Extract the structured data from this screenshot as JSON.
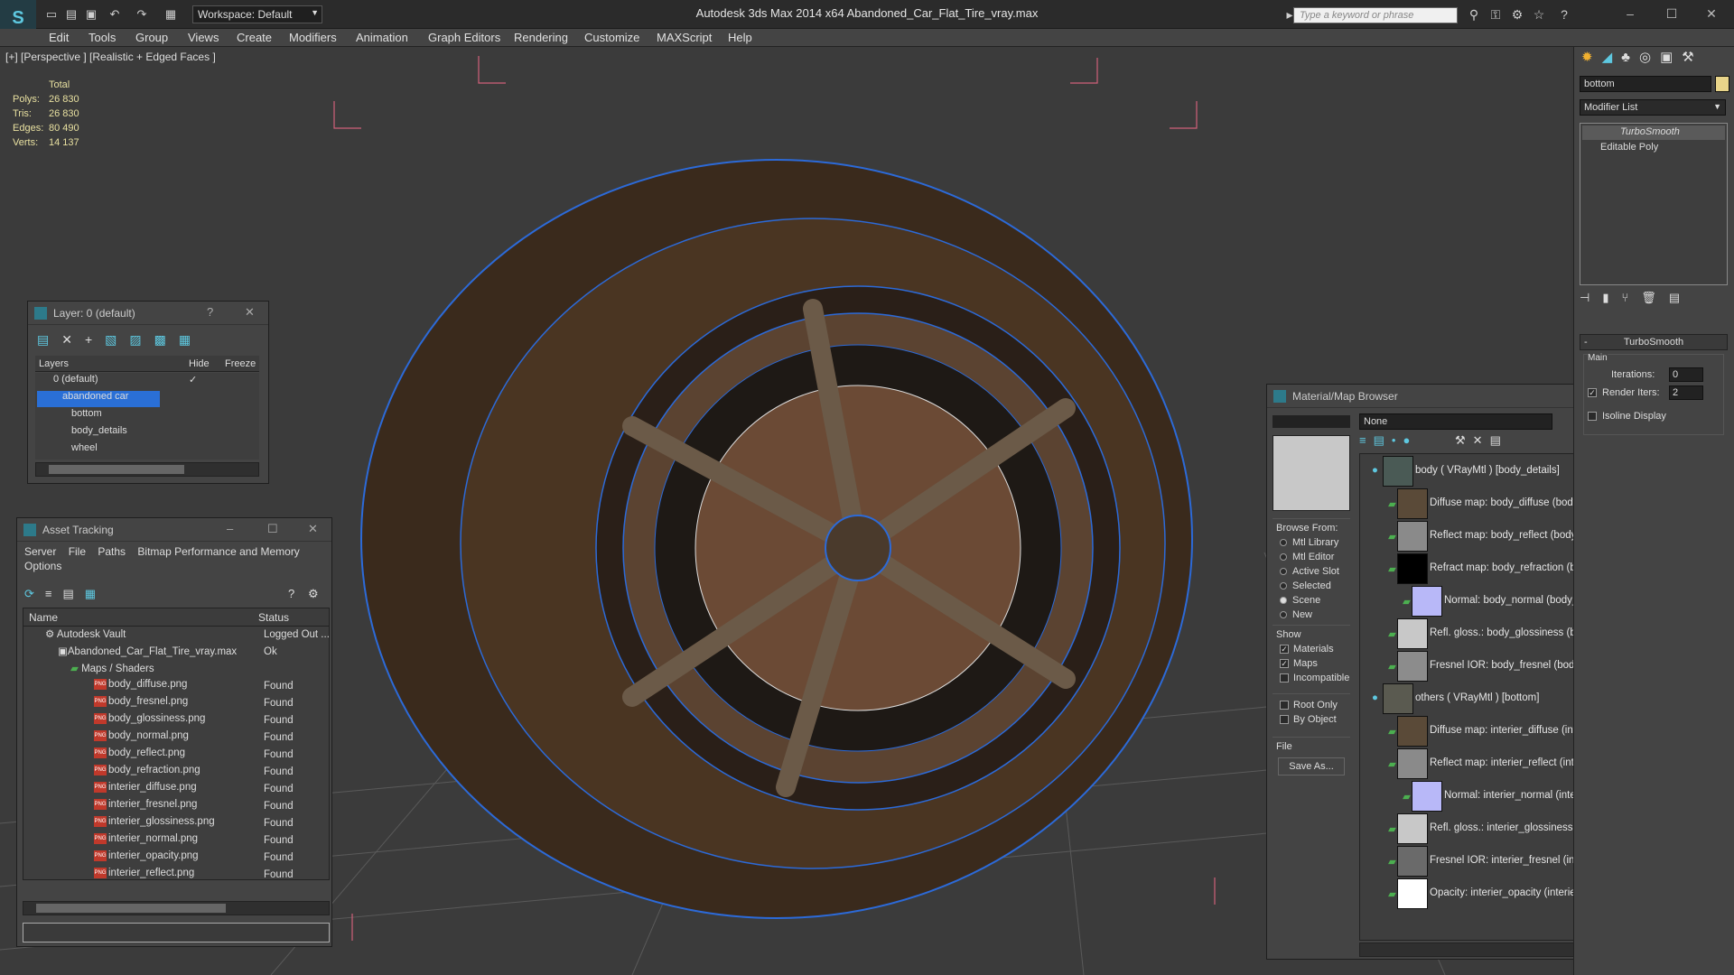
{
  "app": {
    "window_title": "Autodesk 3ds Max  2014 x64     Abandoned_Car_Flat_Tire_vray.max",
    "workspace": "Workspace: Default",
    "search_placeholder": "Type a keyword or phrase"
  },
  "menu": [
    "Edit",
    "Tools",
    "Group",
    "Views",
    "Create",
    "Modifiers",
    "Animation",
    "Graph Editors",
    "Rendering",
    "Customize",
    "MAXScript",
    "Help"
  ],
  "viewport": {
    "label": "[+] [Perspective ] [Realistic + Edged Faces ]",
    "stats_header": "Total",
    "stats": [
      {
        "k": "Polys:",
        "v": "26 830"
      },
      {
        "k": "Tris:",
        "v": "26 830"
      },
      {
        "k": "Edges:",
        "v": "80 490"
      },
      {
        "k": "Verts:",
        "v": "14 137"
      }
    ]
  },
  "layer_panel": {
    "title": "Layer: 0 (default)",
    "help": "?",
    "cols": {
      "layers": "Layers",
      "hide": "Hide",
      "freeze": "Freeze"
    },
    "rows": [
      "0 (default)",
      "abandoned car",
      "bottom",
      "body_details",
      "wheel"
    ]
  },
  "asset_panel": {
    "title": "Asset Tracking",
    "menu": [
      "Server",
      "File",
      "Paths",
      "Bitmap Performance and Memory"
    ],
    "menu2": "Options",
    "cols": {
      "name": "Name",
      "status": "Status"
    },
    "rows": [
      {
        "name": "Autodesk Vault",
        "status": "Logged Out ..."
      },
      {
        "name": "Abandoned_Car_Flat_Tire_vray.max",
        "status": "Ok"
      },
      {
        "name": "Maps / Shaders",
        "status": ""
      },
      {
        "name": "body_diffuse.png",
        "status": "Found"
      },
      {
        "name": "body_fresnel.png",
        "status": "Found"
      },
      {
        "name": "body_glossiness.png",
        "status": "Found"
      },
      {
        "name": "body_normal.png",
        "status": "Found"
      },
      {
        "name": "body_reflect.png",
        "status": "Found"
      },
      {
        "name": "body_refraction.png",
        "status": "Found"
      },
      {
        "name": "interier_diffuse.png",
        "status": "Found"
      },
      {
        "name": "interier_fresnel.png",
        "status": "Found"
      },
      {
        "name": "interier_glossiness.png",
        "status": "Found"
      },
      {
        "name": "interier_normal.png",
        "status": "Found"
      },
      {
        "name": "interier_opacity.png",
        "status": "Found"
      },
      {
        "name": "interier_reflect.png",
        "status": "Found"
      }
    ]
  },
  "material_browser": {
    "title": "Material/Map Browser",
    "search_value": "None",
    "browse_from_label": "Browse From:",
    "browse_from": [
      "Mtl Library",
      "Mtl Editor",
      "Active Slot",
      "Selected",
      "Scene",
      "New"
    ],
    "show_label": "Show",
    "show": [
      "Materials",
      "Maps",
      "Incompatible"
    ],
    "root_only": "Root Only",
    "by_object": "By Object",
    "file_label": "File",
    "save_as": "Save As...",
    "rows": [
      "body  ( VRayMtl )  [body_details]",
      "Diffuse map: body_diffuse (body_diffuse.png)",
      "Reflect map: body_reflect (body_reflect.png)",
      "Refract map: body_refraction (body_refraction.png)",
      "Normal: body_normal (body_normal.png)",
      "Refl. gloss.: body_glossiness (body_glossiness.png)",
      "Fresnel IOR: body_fresnel (body_fresnel.png)",
      "others  ( VRayMtl )  [bottom]",
      "Diffuse map: interier_diffuse (interier_diffuse.png)",
      "Reflect map: interier_reflect (interier_reflect.png)",
      "Normal: interier_normal (interier_normal.png)",
      "Refl. gloss.: interier_glossiness (interier_glossiness.png)",
      "Fresnel IOR: interier_fresnel (interier_fresnel.png)",
      "Opacity: interier_opacity (interier_opacity.png)"
    ]
  },
  "command_panel": {
    "object_name": "bottom",
    "modifier_list": "Modifier List",
    "stack": [
      "TurboSmooth",
      "Editable Poly"
    ],
    "rollout_title": "TurboSmooth",
    "main_label": "Main",
    "iterations_label": "Iterations:",
    "iterations_value": "0",
    "render_iters_label": "Render Iters:",
    "render_iters_value": "2",
    "isoline_label": "Isoline Display"
  },
  "colors": {
    "accent": "#3399ff",
    "selected": "#2a6fd6",
    "object_color": "#e8d48a"
  }
}
